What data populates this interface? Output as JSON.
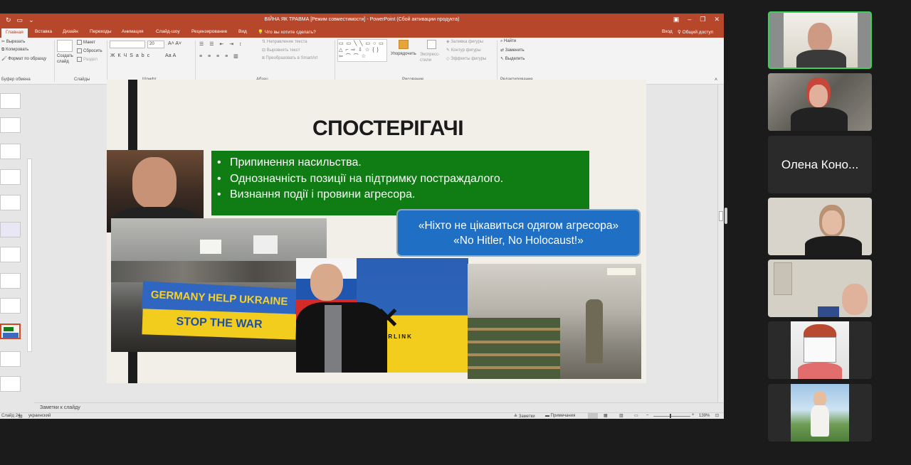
{
  "window": {
    "title": "ВІЙНА ЯК ТРАВМА [Режим совместимости] - PowerPoint (Сбой активации продукта)",
    "share_label": "Общий доступ",
    "signin_label": "Вход"
  },
  "tabs": [
    {
      "label": "Главная"
    },
    {
      "label": "Вставка"
    },
    {
      "label": "Дизайн"
    },
    {
      "label": "Переходы"
    },
    {
      "label": "Анимация"
    },
    {
      "label": "Слайд-шоу"
    },
    {
      "label": "Рецензирование"
    },
    {
      "label": "Вид"
    },
    {
      "label": "Что вы хотите сделать?"
    }
  ],
  "ribbon": {
    "clipboard": {
      "cut": "Вырезать",
      "copy": "Копировать",
      "format": "Формат по образцу",
      "group": "Буфер обмена"
    },
    "slides": {
      "new": "Создать слайд",
      "layout": "Макет",
      "reset": "Сбросить",
      "section": "Раздел",
      "group": "Слайды"
    },
    "font": {
      "size": "20",
      "group": "Шрифт"
    },
    "paragraph": {
      "direction": "Направление текста",
      "align": "Выровнять текст",
      "smartart": "Преобразовать в SmartArt",
      "group": "Абзац"
    },
    "drawing": {
      "arrange": "Упорядочить",
      "quick": "Экспресс-стили",
      "fill": "Заливка фигуры",
      "outline": "Контур фигуры",
      "effects": "Эффекты фигуры",
      "group": "Рисование"
    },
    "editing": {
      "find": "Найти",
      "replace": "Заменить",
      "select": "Выделить",
      "group": "Редактирование"
    }
  },
  "slide": {
    "title": "СПОСТЕРІГАЧІ",
    "bullets": [
      "Припинення насильства.",
      "Однозначність позиції на підтримку постраждалого.",
      "Визнання події і провини агресора."
    ],
    "quote_line1": "«Ніхто не цікавиться одягом агресора»",
    "quote_line2": "«No Hitler, No Holocaust!»",
    "banner_line1": "GERMANY HELP UKRAINE",
    "banner_line2": "STOP THE WAR",
    "starlink_label": "STARLINK"
  },
  "notes_placeholder": "Заметки к слайду",
  "status": {
    "slide_number": "Слайд 24",
    "language": "украинский",
    "notes_btn": "Заметки",
    "comments_btn": "Примечания",
    "zoom": "139%"
  },
  "participants": [
    {
      "name": "",
      "active": true
    },
    {
      "name": "",
      "active": false
    },
    {
      "name": "Олена Коно...",
      "active": false
    },
    {
      "name": "",
      "active": false
    },
    {
      "name": "",
      "active": false
    },
    {
      "name": "",
      "active": false
    },
    {
      "name": "",
      "active": false
    }
  ],
  "colors": {
    "ppt_accent": "#b7472a",
    "green_box": "#0f7d13",
    "blue_box": "#1f6fc5",
    "speaker_border": "#3bd05b"
  }
}
